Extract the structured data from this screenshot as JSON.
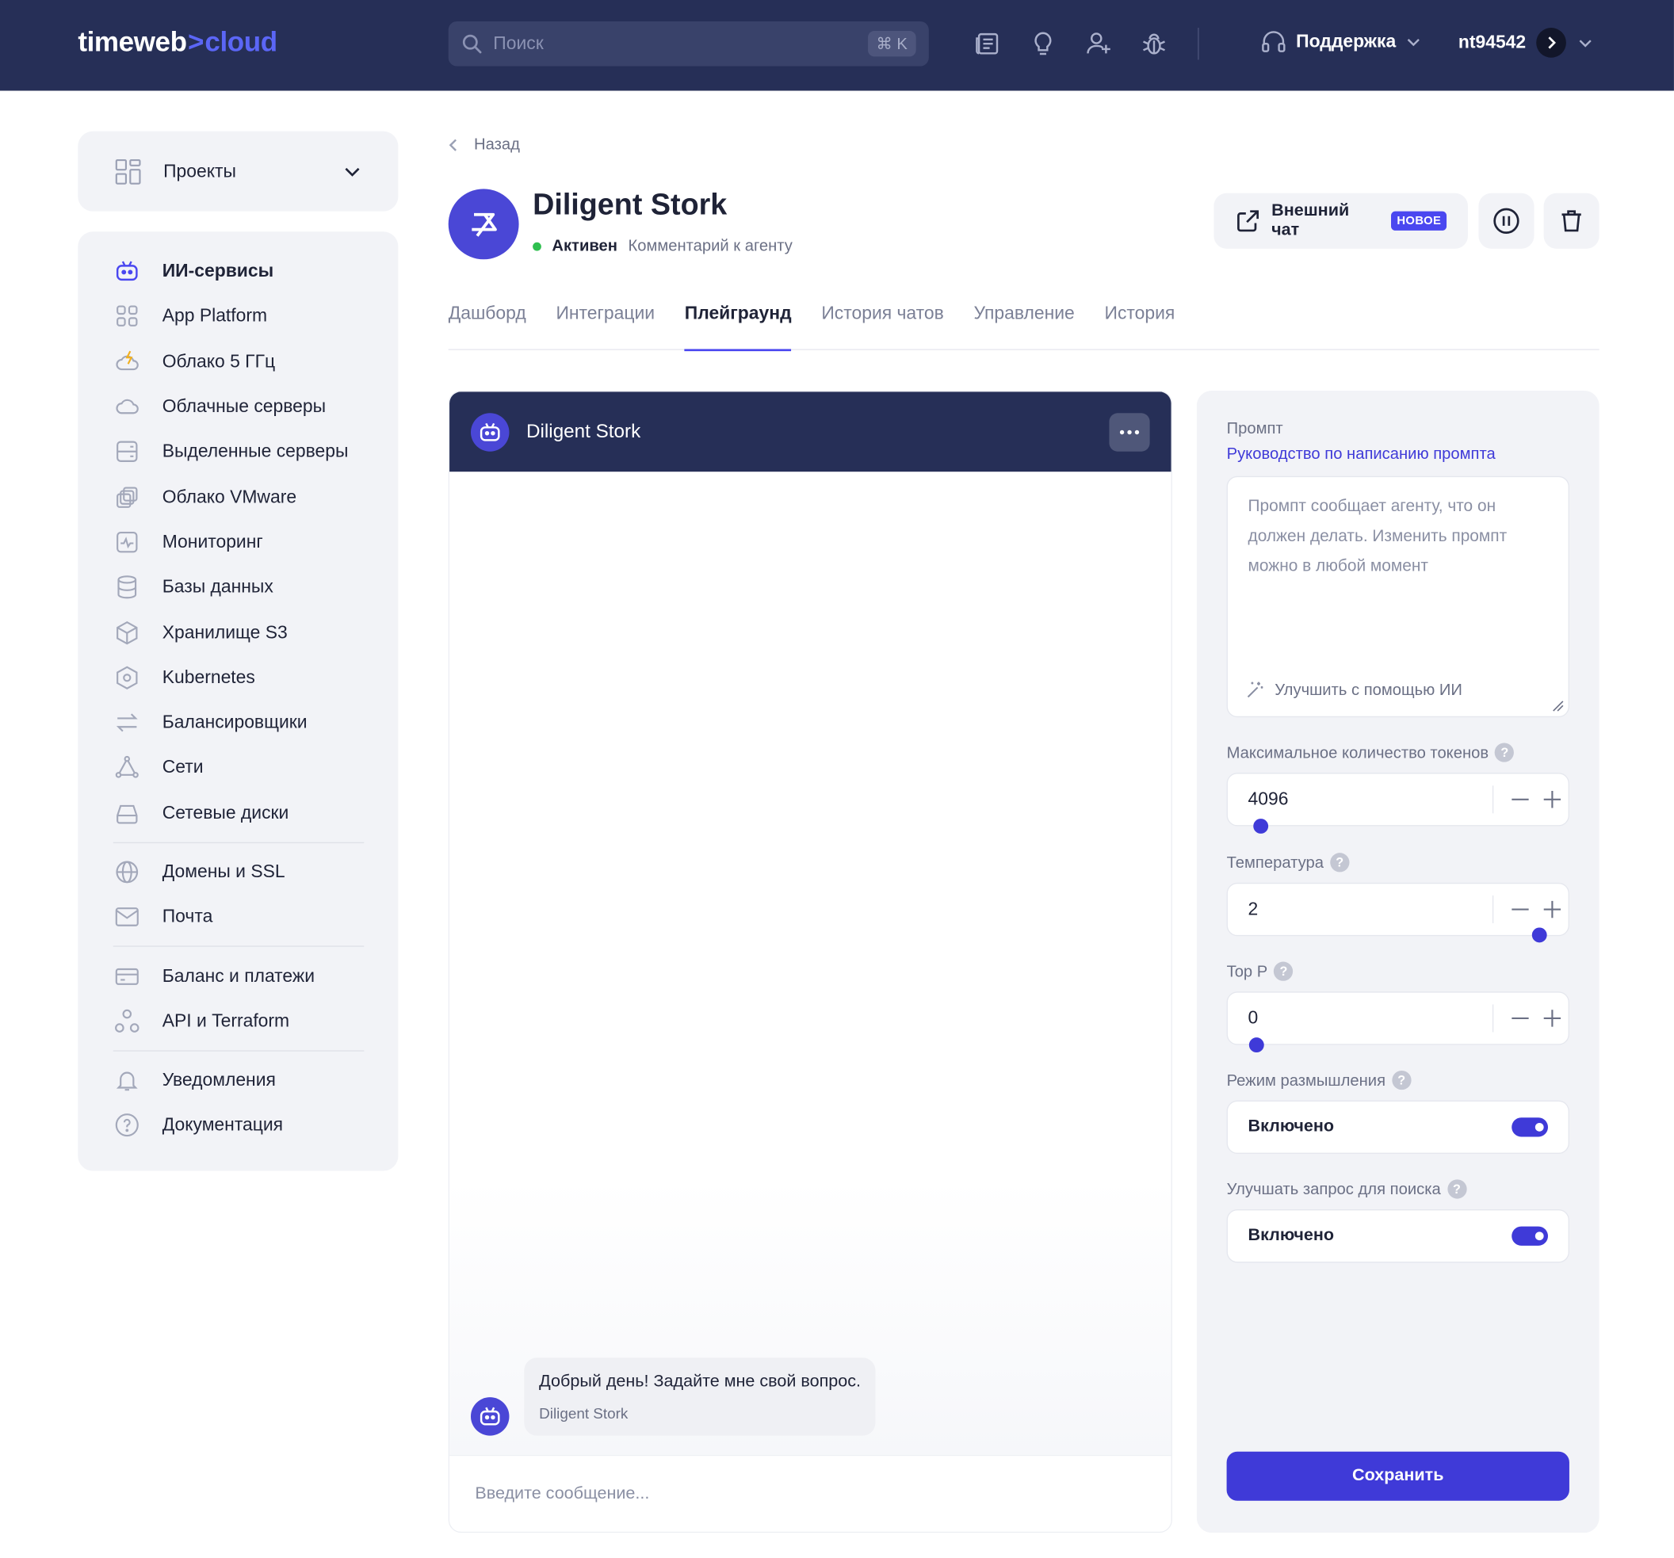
{
  "topbar": {
    "logo_main": "timeweb",
    "logo_arrow": ">",
    "logo_accent": "cloud",
    "search_placeholder": "Поиск",
    "search_shortcut": "⌘ K",
    "support_label": "Поддержка",
    "username": "nt94542"
  },
  "sidebar": {
    "projects_label": "Проекты",
    "items": [
      {
        "label": "ИИ-сервисы",
        "icon": "robot-icon",
        "active": true
      },
      {
        "label": "App Platform",
        "icon": "app-grid-icon"
      },
      {
        "label": "Облако 5 ГГц",
        "icon": "cloud-bolt-icon"
      },
      {
        "label": "Облачные серверы",
        "icon": "cloud-icon"
      },
      {
        "label": "Выделенные серверы",
        "icon": "server-icon"
      },
      {
        "label": "Облако VMware",
        "icon": "vmware-icon"
      },
      {
        "label": "Мониторинг",
        "icon": "monitoring-icon"
      },
      {
        "label": "Базы данных",
        "icon": "database-icon"
      },
      {
        "label": "Хранилище S3",
        "icon": "cube-icon"
      },
      {
        "label": "Kubernetes",
        "icon": "kubernetes-icon"
      },
      {
        "label": "Балансировщики",
        "icon": "balancer-icon"
      },
      {
        "label": "Сети",
        "icon": "network-icon"
      },
      {
        "label": "Сетевые диски",
        "icon": "disk-icon"
      },
      {
        "label": "Домены и SSL",
        "icon": "globe-icon"
      },
      {
        "label": "Почта",
        "icon": "mail-icon"
      },
      {
        "label": "Баланс и платежи",
        "icon": "card-icon"
      },
      {
        "label": "API и Terraform",
        "icon": "api-icon"
      },
      {
        "label": "Уведомления",
        "icon": "bell-icon"
      },
      {
        "label": "Документация",
        "icon": "question-circle-icon"
      }
    ]
  },
  "header": {
    "back_label": "Назад",
    "agent_name": "Diligent Stork",
    "status": "Активен",
    "comment_link": "Комментарий к агенту",
    "external_chat_label": "Внешний чат",
    "external_chat_badge": "НОВОЕ"
  },
  "tabs": [
    {
      "label": "Дашборд"
    },
    {
      "label": "Интеграции"
    },
    {
      "label": "Плейграунд",
      "active": true
    },
    {
      "label": "История чатов"
    },
    {
      "label": "Управление"
    },
    {
      "label": "История"
    }
  ],
  "chat": {
    "title": "Diligent Stork",
    "message_text": "Добрый день! Задайте мне свой вопрос.",
    "message_sender": "Diligent Stork",
    "input_placeholder": "Введите сообщение..."
  },
  "settings": {
    "prompt_label": "Промпт",
    "prompt_guide_link": "Руководство по написанию промпта",
    "prompt_placeholder": "Промпт сообщает агенту, что он должен делать. Изменить промпт можно в любой момент",
    "improve_label": "Улучшить с помощью ИИ",
    "max_tokens": {
      "label": "Максимальное количество токенов",
      "value": "4096",
      "slider_fraction": 0.0
    },
    "temperature": {
      "label": "Температура",
      "value": "2",
      "slider_fraction": 1.0
    },
    "top_p": {
      "label": "Top P",
      "value": "0",
      "slider_fraction": 0.0
    },
    "thinking_mode": {
      "label": "Режим размышления",
      "value_label": "Включено",
      "enabled": true
    },
    "search_improve": {
      "label": "Улучшать запрос для поиска",
      "value_label": "Включено",
      "enabled": true
    },
    "help_glyph": "?",
    "save_label": "Сохранить"
  },
  "colors": {
    "topbar_bg": "#262f57",
    "accent": "#3f3ad8",
    "panel_bg": "#f2f3f7",
    "status_active": "#2fbf4f"
  }
}
